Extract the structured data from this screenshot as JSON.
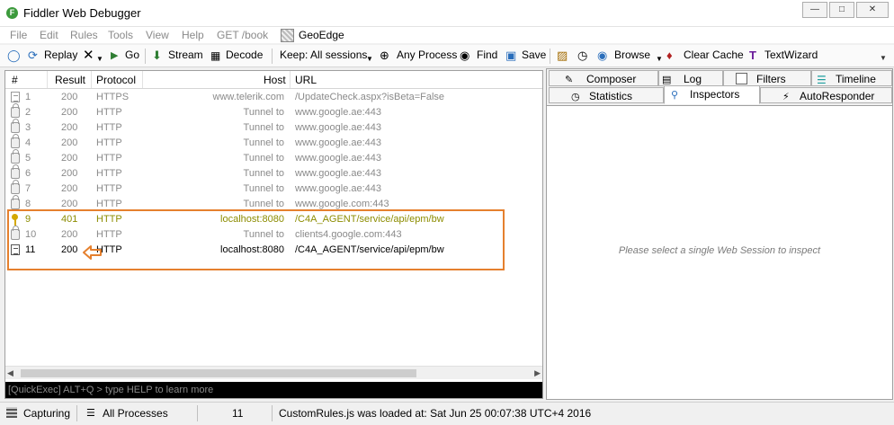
{
  "window": {
    "title": "Fiddler Web Debugger",
    "icon_letter": "F"
  },
  "menu": {
    "items": [
      "File",
      "Edit",
      "Rules",
      "Tools",
      "View",
      "Help",
      "GET /book"
    ],
    "geoedge": "GeoEdge"
  },
  "toolbar": {
    "replay": "Replay",
    "go": "Go",
    "stream": "Stream",
    "decode": "Decode",
    "keep": "Keep: All sessions",
    "any_process": "Any Process",
    "find": "Find",
    "save": "Save",
    "browse": "Browse",
    "clear_cache": "Clear Cache",
    "textwizard": "TextWizard"
  },
  "grid": {
    "headers": {
      "num": "#",
      "result": "Result",
      "protocol": "Protocol",
      "host": "Host",
      "url": "URL"
    },
    "rows": [
      {
        "num": "1",
        "result": "200",
        "protocol": "HTTPS",
        "host": "www.telerik.com",
        "url": "/UpdateCheck.aspx?isBeta=False",
        "style": "gray",
        "icon": "doc-gray"
      },
      {
        "num": "2",
        "result": "200",
        "protocol": "HTTP",
        "host": "Tunnel to",
        "url": "www.google.ae:443",
        "style": "gray",
        "icon": "lock"
      },
      {
        "num": "3",
        "result": "200",
        "protocol": "HTTP",
        "host": "Tunnel to",
        "url": "www.google.ae:443",
        "style": "gray",
        "icon": "lock"
      },
      {
        "num": "4",
        "result": "200",
        "protocol": "HTTP",
        "host": "Tunnel to",
        "url": "www.google.ae:443",
        "style": "gray",
        "icon": "lock"
      },
      {
        "num": "5",
        "result": "200",
        "protocol": "HTTP",
        "host": "Tunnel to",
        "url": "www.google.ae:443",
        "style": "gray",
        "icon": "lock"
      },
      {
        "num": "6",
        "result": "200",
        "protocol": "HTTP",
        "host": "Tunnel to",
        "url": "www.google.ae:443",
        "style": "gray",
        "icon": "lock"
      },
      {
        "num": "7",
        "result": "200",
        "protocol": "HTTP",
        "host": "Tunnel to",
        "url": "www.google.ae:443",
        "style": "gray",
        "icon": "lock"
      },
      {
        "num": "8",
        "result": "200",
        "protocol": "HTTP",
        "host": "Tunnel to",
        "url": "www.google.com:443",
        "style": "gray",
        "icon": "lock"
      },
      {
        "num": "9",
        "result": "401",
        "protocol": "HTTP",
        "host": "localhost:8080",
        "url": "/C4A_AGENT/service/api/epm/bw",
        "style": "olive",
        "icon": "key"
      },
      {
        "num": "10",
        "result": "200",
        "protocol": "HTTP",
        "host": "Tunnel to",
        "url": "clients4.google.com:443",
        "style": "gray",
        "icon": "lock"
      },
      {
        "num": "11",
        "result": "200",
        "protocol": "HTTP",
        "host": "localhost:8080",
        "url": "/C4A_AGENT/service/api/epm/bw",
        "style": "black",
        "icon": "doc"
      }
    ]
  },
  "quickexec": {
    "text": "[QuickExec] ALT+Q > type HELP to learn more"
  },
  "tabs": {
    "composer": "Composer",
    "log": "Log",
    "filters": "Filters",
    "timeline": "Timeline",
    "statistics": "Statistics",
    "inspectors": "Inspectors",
    "autoresponder": "AutoResponder"
  },
  "inspector": {
    "empty_message": "Please select a single Web Session to inspect"
  },
  "status": {
    "capturing": "Capturing",
    "processes": "All Processes",
    "count": "11",
    "message": "CustomRules.js was loaded at: Sat Jun 25 00:07:38 UTC+4 2016"
  },
  "colors": {
    "highlight": "#e5802e",
    "row_gray": "#8a8a8a",
    "row_olive": "#8c8c00"
  }
}
